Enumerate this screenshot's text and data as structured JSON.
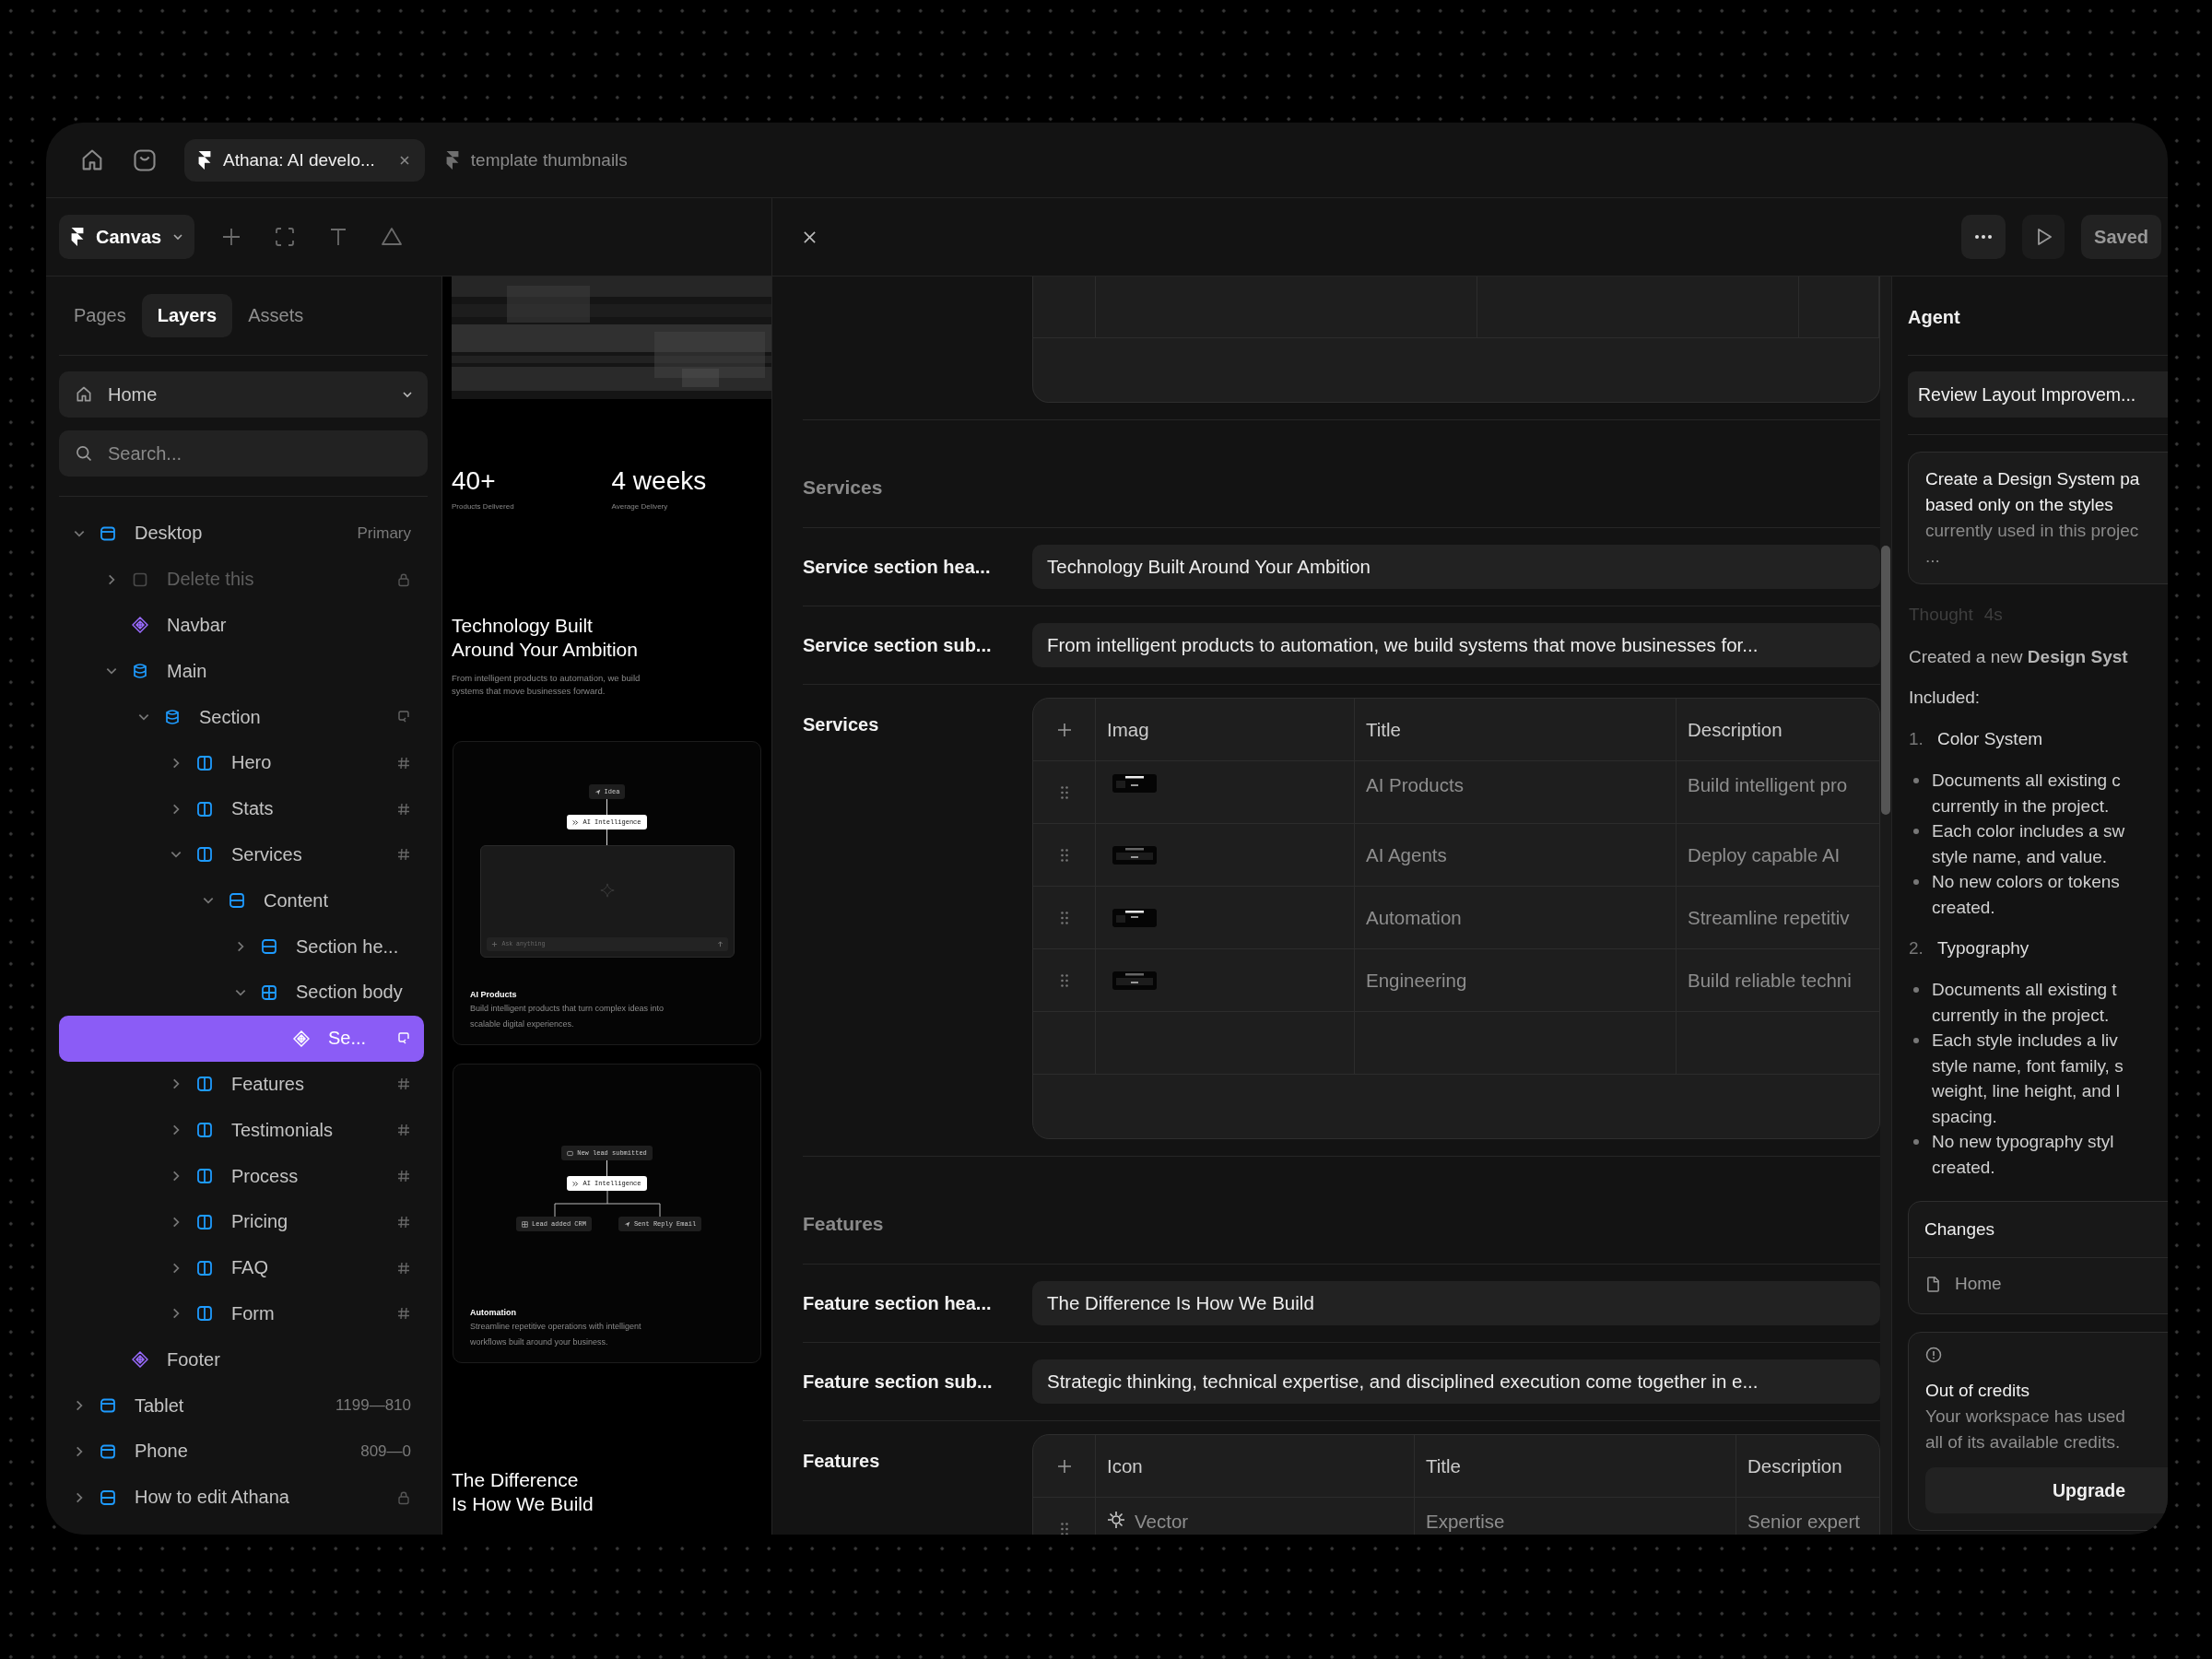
{
  "tabs": [
    {
      "label": "Athana: AI develo...",
      "selected": true
    },
    {
      "label": "template thumbnails",
      "selected": false
    }
  ],
  "toolbar": {
    "menu": "Canvas"
  },
  "panel_tabs": [
    {
      "label": "Pages",
      "selected": false
    },
    {
      "label": "Layers",
      "selected": true
    },
    {
      "label": "Assets",
      "selected": false
    }
  ],
  "page_select": {
    "value": "Home"
  },
  "layer_search": {
    "placeholder": "Search..."
  },
  "layers": [
    {
      "name": "Desktop",
      "kind": "frame",
      "expanded": true,
      "hidden": false,
      "selected": false,
      "note": "Primary",
      "children": [
        {
          "name": "Delete this",
          "kind": "box",
          "expanded": false,
          "hidden": true,
          "selected": false,
          "badge": {
            "kind": "lock"
          }
        },
        {
          "name": "Navbar",
          "kind": "component",
          "hidden": false,
          "selected": false
        },
        {
          "name": "Main",
          "kind": "stack",
          "expanded": true,
          "hidden": false,
          "selected": false,
          "children": [
            {
              "name": "Section",
              "kind": "stack",
              "expanded": true,
              "hidden": false,
              "selected": false,
              "badge": {
                "kind": "sync"
              },
              "children": [
                {
                  "name": "Hero",
                  "kind": "columns",
                  "expanded": false,
                  "hidden": false,
                  "selected": false,
                  "badge": {
                    "kind": "hash"
                  }
                },
                {
                  "name": "Stats",
                  "kind": "columns",
                  "expanded": false,
                  "hidden": false,
                  "selected": false,
                  "badge": {
                    "kind": "hash"
                  }
                },
                {
                  "name": "Services",
                  "kind": "columns",
                  "expanded": true,
                  "hidden": false,
                  "selected": false,
                  "badge": {
                    "kind": "hash"
                  },
                  "children": [
                    {
                      "name": "Content",
                      "kind": "rows",
                      "expanded": true,
                      "hidden": false,
                      "selected": false,
                      "children": [
                        {
                          "name": "Section he...",
                          "kind": "rows",
                          "expanded": false,
                          "hidden": false,
                          "selected": false
                        },
                        {
                          "name": "Section body",
                          "kind": "grid",
                          "expanded": true,
                          "hidden": false,
                          "selected": false,
                          "children": [
                            {
                              "name": "Se...",
                              "kind": "component",
                              "hidden": false,
                              "selected": true,
                              "badge": {
                                "kind": "sync"
                              }
                            }
                          ]
                        }
                      ]
                    }
                  ]
                },
                {
                  "name": "Features",
                  "kind": "columns",
                  "expanded": false,
                  "hidden": false,
                  "selected": false,
                  "badge": {
                    "kind": "hash"
                  }
                },
                {
                  "name": "Testimonials",
                  "kind": "columns",
                  "expanded": false,
                  "hidden": false,
                  "selected": false,
                  "badge": {
                    "kind": "hash"
                  }
                },
                {
                  "name": "Process",
                  "kind": "columns",
                  "expanded": false,
                  "hidden": false,
                  "selected": false,
                  "badge": {
                    "kind": "hash"
                  }
                },
                {
                  "name": "Pricing",
                  "kind": "columns",
                  "expanded": false,
                  "hidden": false,
                  "selected": false,
                  "badge": {
                    "kind": "hash"
                  }
                },
                {
                  "name": "FAQ",
                  "kind": "columns",
                  "expanded": false,
                  "hidden": false,
                  "selected": false,
                  "badge": {
                    "kind": "hash"
                  }
                },
                {
                  "name": "Form",
                  "kind": "columns",
                  "expanded": false,
                  "hidden": false,
                  "selected": false,
                  "badge": {
                    "kind": "hash"
                  }
                }
              ]
            }
          ]
        },
        {
          "name": "Footer",
          "kind": "component",
          "hidden": false,
          "selected": false
        }
      ]
    },
    {
      "name": "Tablet",
      "kind": "frame",
      "expanded": false,
      "hidden": false,
      "selected": false,
      "note": "1199—810"
    },
    {
      "name": "Phone",
      "kind": "frame",
      "expanded": false,
      "hidden": false,
      "selected": false,
      "note": "809—0"
    },
    {
      "name": "How to edit Athana",
      "kind": "rows",
      "expanded": false,
      "hidden": false,
      "selected": false,
      "badge": {
        "kind": "lock"
      }
    }
  ],
  "preview": {
    "stats": [
      {
        "value": "40+",
        "label": "Products Delivered"
      },
      {
        "value": "4 weeks",
        "label": "Average Delivery"
      }
    ],
    "heading": "Technology Built Around Your Ambition",
    "intro": "From intelligent products to automation, we build systems that move businesses forward.",
    "cards": [
      {
        "kind": "assistant",
        "steps": [
          {
            "label": "Idea",
            "kind": "send"
          },
          {
            "label": "AI Intelligence",
            "kind": "spark"
          }
        ],
        "prompt": "Ask anything",
        "title": "AI Products",
        "text": "Build intelligent products that turn complex ideas into scalable digital experiences."
      },
      {
        "kind": "workflow",
        "steps": [
          {
            "label": "New lead submitted",
            "kind": "inbox"
          },
          {
            "label": "AI Intelligence",
            "kind": "spark"
          }
        ],
        "branches": [
          {
            "label": "Lead added CRM",
            "kind": "grid"
          },
          {
            "label": "Sent Reply Email",
            "kind": "send"
          }
        ],
        "title": "Automation",
        "text": "Streamline repetitive operations with intelligent workflows built around your business."
      }
    ],
    "closing": "The Difference Is How We Build"
  },
  "editor": {
    "status": "Saved",
    "sections": [
      {
        "title": "Services",
        "fields": [
          {
            "label": "Service section hea...",
            "value": "Technology Built Around Your Ambition"
          },
          {
            "label": "Service section sub...",
            "value": "From intelligent products to automation, we build systems that move businesses for..."
          }
        ],
        "list": {
          "label": "Services",
          "columns": [
            "Imag",
            "Title",
            "Description"
          ],
          "rows": [
            {
              "title": "AI Products",
              "description": "Build intelligent pro"
            },
            {
              "title": "AI Agents",
              "description": "Deploy capable AI"
            },
            {
              "title": "Automation",
              "description": "Streamline repetitiv"
            },
            {
              "title": "Engineering",
              "description": "Build reliable techni"
            }
          ]
        }
      },
      {
        "title": "Features",
        "fields": [
          {
            "label": "Feature section hea...",
            "value": "The Difference Is How We Build"
          },
          {
            "label": "Feature section sub...",
            "value": "Strategic thinking, technical expertise, and disciplined execution come together in e..."
          }
        ],
        "list": {
          "label": "Features",
          "kind": "icon",
          "columns": [
            "Icon",
            "Title",
            "Description"
          ],
          "rows": [
            {
              "media": "Vector",
              "title": "Expertise",
              "description": "Senior expert"
            }
          ]
        }
      }
    ]
  },
  "agent": {
    "title": "Agent",
    "thread": "Review Layout Improvem...",
    "prompt": [
      "Create a Design System pa",
      "based only on the styles",
      "currently used in this projec",
      "..."
    ],
    "thought": {
      "label": "Thought",
      "time": "4s"
    },
    "summary": "Created a new **Design Syst**",
    "lead": "Included:",
    "groups": [
      {
        "number": "1.",
        "title": "Color System",
        "bullets": [
          [
            "Documents all existing c",
            "currently in the project."
          ],
          [
            "Each color includes a sw",
            "style name, and value."
          ],
          [
            "No new colors or tokens",
            "created."
          ]
        ]
      },
      {
        "number": "2.",
        "title": "Typography",
        "bullets": [
          [
            "Documents all existing t",
            "currently in the project."
          ],
          [
            "Each style includes a liv",
            "style name, font family, s",
            "weight, line height, and l",
            "spacing."
          ],
          [
            "No new typography styl",
            "created."
          ]
        ]
      }
    ],
    "changes": {
      "title": "Changes",
      "files": [
        "Home"
      ]
    },
    "credits": {
      "title": "Out of credits",
      "text": [
        "Your workspace has used",
        "all of its available credits."
      ],
      "action": "Upgrade"
    }
  }
}
